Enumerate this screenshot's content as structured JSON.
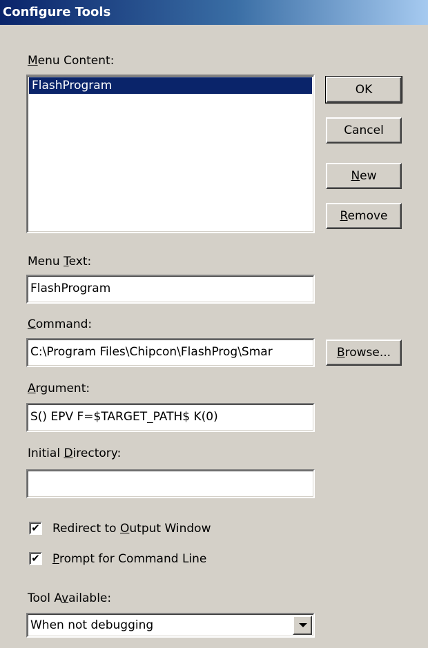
{
  "dialog": {
    "title": "Configure Tools"
  },
  "labels": {
    "menu_content_accel": "M",
    "menu_content_rest": "enu Content:",
    "menu_text_pre": "Menu ",
    "menu_text_accel": "T",
    "menu_text_rest": "ext:",
    "command_accel": "C",
    "command_rest": "ommand:",
    "argument_accel": "A",
    "argument_rest": "rgument:",
    "initdir_pre": "Initial ",
    "initdir_accel": "D",
    "initdir_rest": "irectory:",
    "tool_avail_pre": "Tool A",
    "tool_avail_accel": "v",
    "tool_avail_rest": "ailable:"
  },
  "menu_content": {
    "items": [
      "FlashProgram"
    ],
    "selected_index": 0
  },
  "fields": {
    "menu_text": "FlashProgram",
    "command": "C:\\Program Files\\Chipcon\\FlashProg\\Smar",
    "argument": "S() EPV F=$TARGET_PATH$ K(0)",
    "initial_directory": ""
  },
  "buttons": {
    "ok": "OK",
    "cancel": "Cancel",
    "new_accel": "N",
    "new_rest": "ew",
    "remove_accel": "R",
    "remove_rest": "emove",
    "browse_accel": "B",
    "browse_rest": "rowse..."
  },
  "checkboxes": {
    "redirect": {
      "pre": "Redirect to ",
      "accel": "O",
      "rest": "utput Window",
      "checked": true,
      "mark": "✔"
    },
    "prompt": {
      "pre": "",
      "accel": "P",
      "rest": "rompt for Command Line",
      "checked": true,
      "mark": "✔"
    }
  },
  "tool_available": {
    "selected": "When not debugging"
  },
  "colors": {
    "face": "#d4d0c8",
    "selection": "#0a246a",
    "title_start": "#0a246a",
    "title_end": "#a6caf0"
  },
  "icons": {
    "combo_arrow": "chevron-down-icon",
    "check": "checkmark-icon"
  }
}
